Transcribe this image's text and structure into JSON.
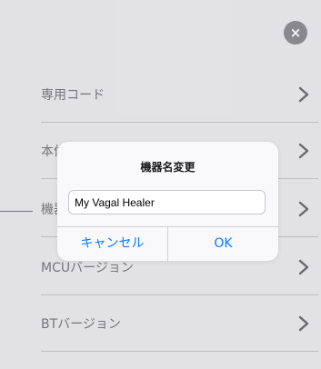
{
  "close_button": {
    "icon": "close-icon",
    "glyph": "×"
  },
  "menu": {
    "items": [
      {
        "label": "専用コード"
      },
      {
        "label": "本体"
      },
      {
        "label": "機器名"
      },
      {
        "label": "MCUバージョン"
      },
      {
        "label": "BTバージョン"
      }
    ]
  },
  "dialog": {
    "title": "機器名変更",
    "input_value": "My Vagal Healer",
    "cancel_label": "キャンセル",
    "ok_label": "OK"
  },
  "colors": {
    "background": "#ececee",
    "accent": "#0a7aff",
    "close_button": "#8e8e93",
    "label_text": "#7a7a7f"
  }
}
